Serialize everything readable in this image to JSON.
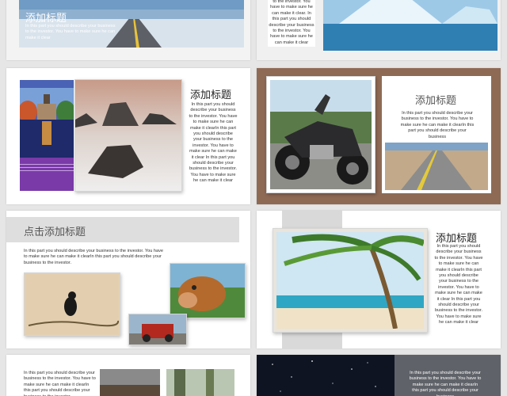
{
  "colors": {
    "background": "#e6e6e6",
    "brown_slide": "#8e6a55",
    "purple": "#7a3aa8",
    "gray_band": "#dedede"
  },
  "slide1": {
    "title": "添加标题",
    "body": "In this part you should describe your business to the investor. You have to make sure he can make it clear"
  },
  "slide2": {
    "body": "to the investor. You have to make sure he can make it clear. In this part you should describe your business to the investor. You have to make sure he can make it clear"
  },
  "slide3": {
    "title": "添加标题",
    "body": "In this part you should describe your business to the investor. You have to make sure he can make it clearIn this part you should describe your business to the investor. You have to make sure he can make it clear In this part you should describe your business to the investor. You have to make sure he can make it clear"
  },
  "slide4": {
    "title": "添加标题",
    "body": "In this part you should describe your business to the investor. You have to make sure he can make it clearIn this part you should describe your business"
  },
  "slide5": {
    "title": "点击添加标题",
    "body": "In this part you should describe your business to the investor. You have to make sure he can make it clearIn this part you should describe your business to the investor."
  },
  "slide6": {
    "title": "添加标题",
    "body": "In this part you should describe your business to the investor. You have to make sure he can make it clearIn this part you should describe your business to the investor. You have to make sure he can make it clear In this part you should describe your business to the investor. You have to make sure he can make it clear"
  },
  "slide7": {
    "body": "In this part you should describe your business to the investor. You have to make sure he can make it clearIn this part you should describe your business to the investor."
  },
  "slide8": {
    "body": "In this part you should describe your business to the investor. You have to make sure he can make it clearIn this part you should describe your business"
  }
}
